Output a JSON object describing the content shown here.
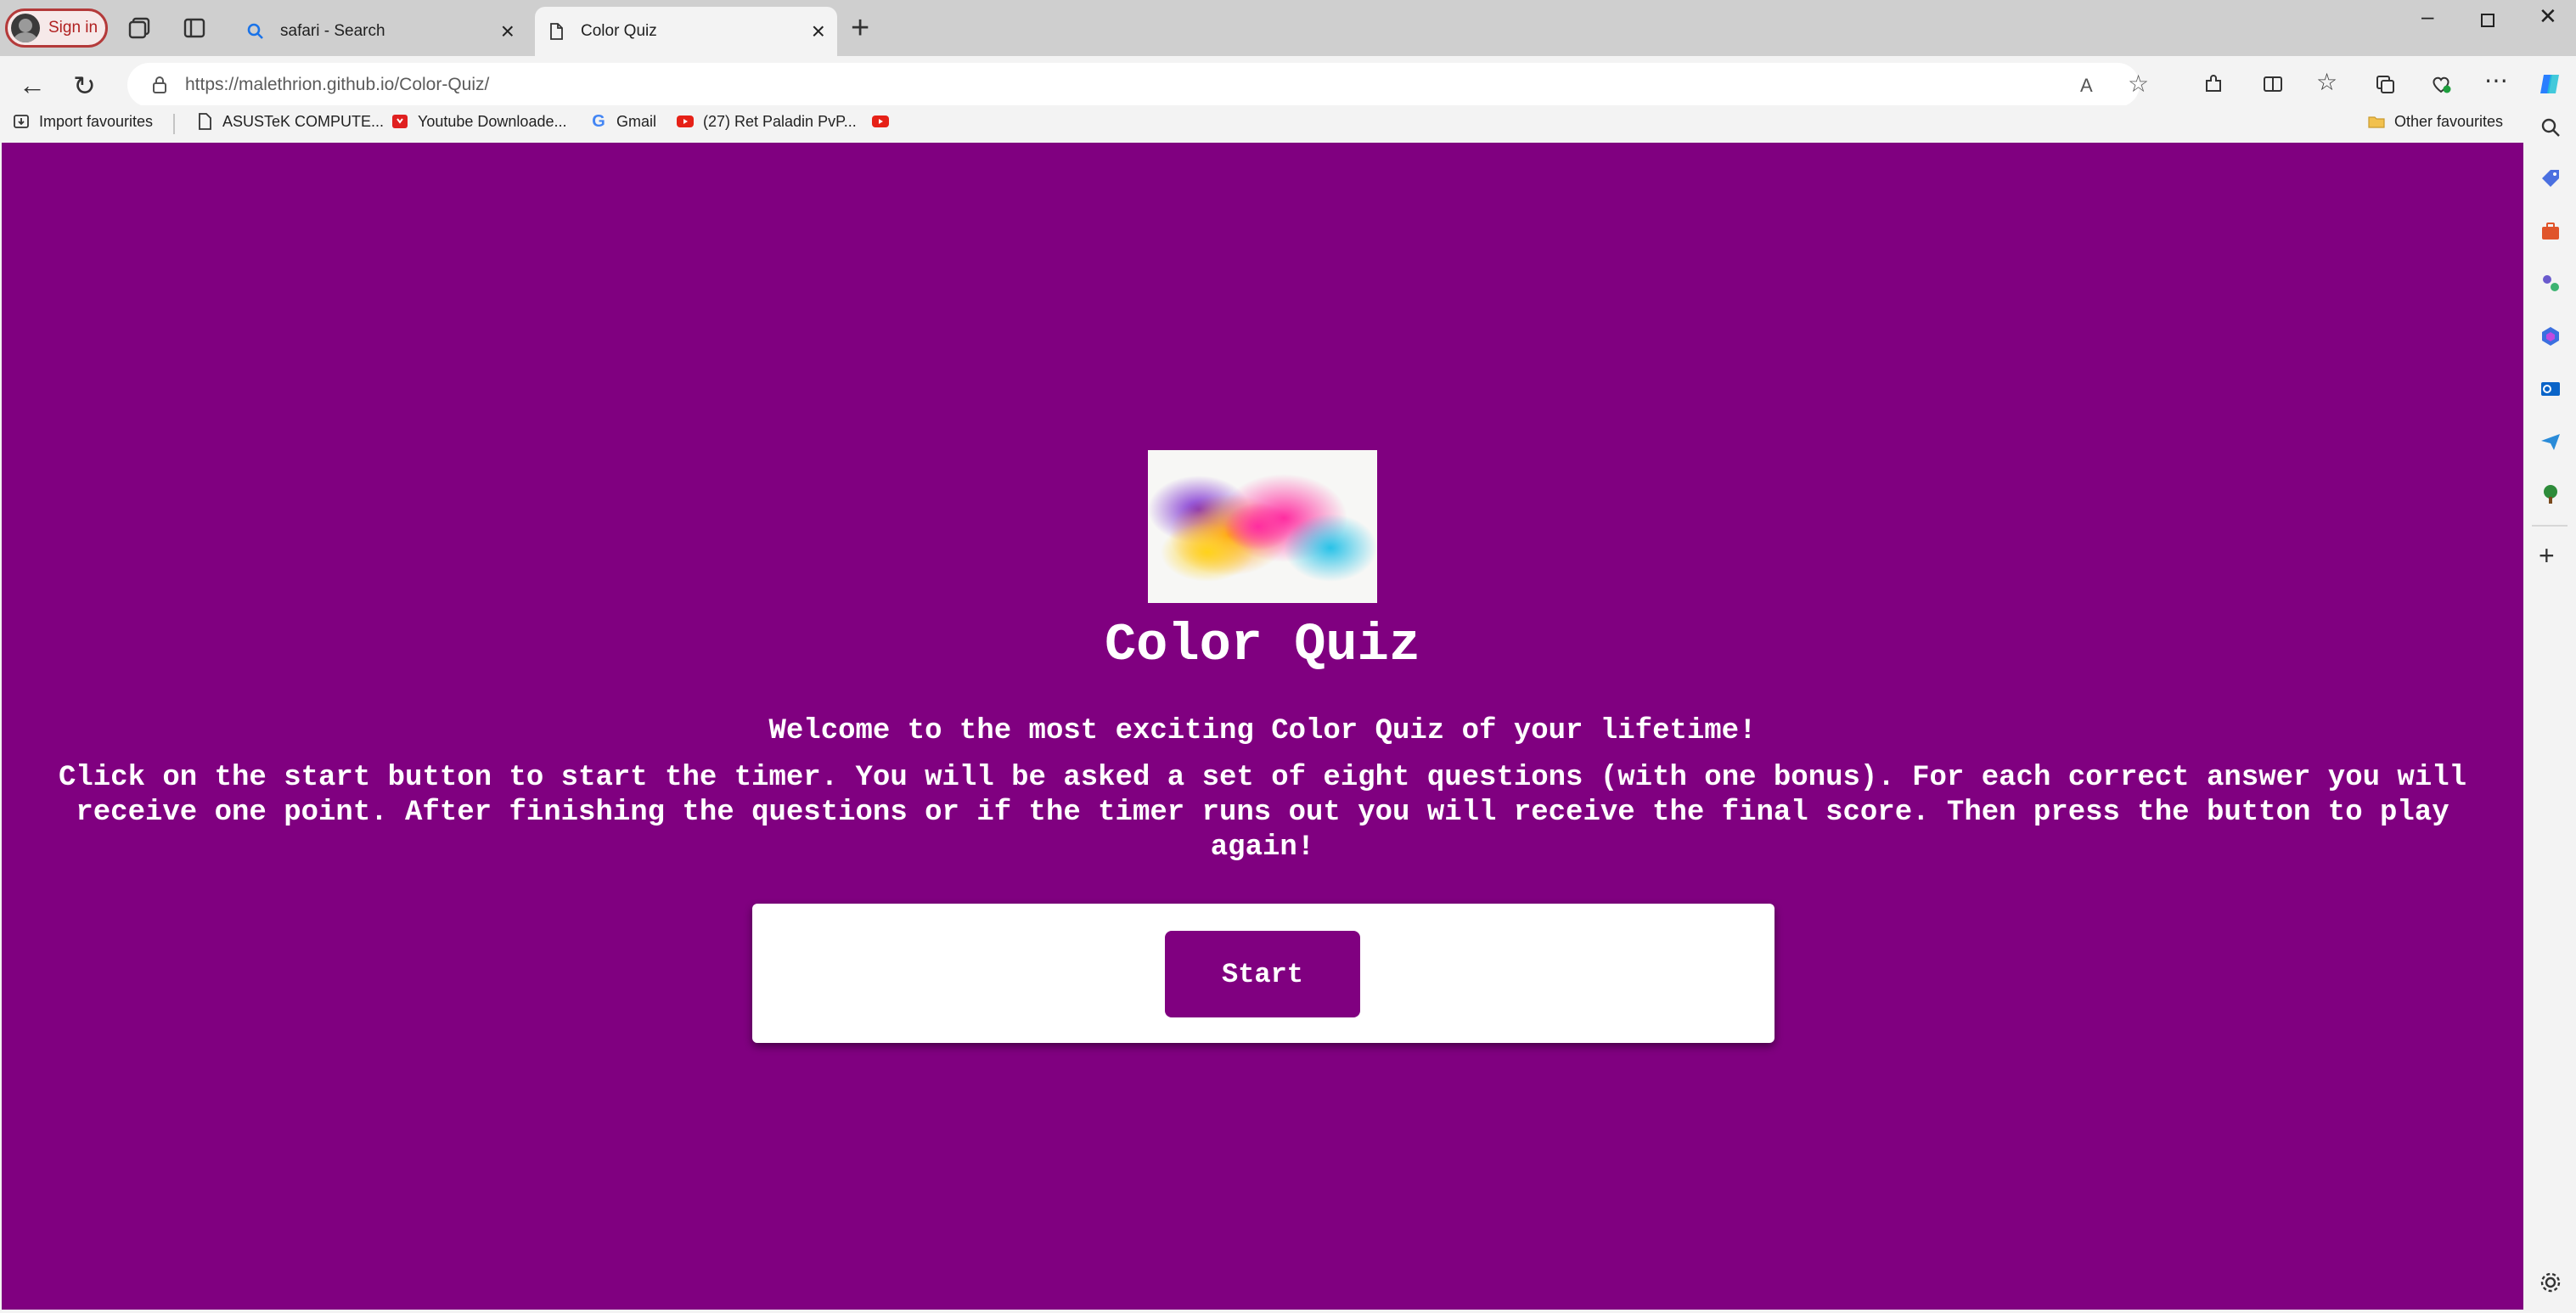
{
  "browser": {
    "signin_label": "Sign in",
    "tabs": [
      {
        "label": "safari - Search",
        "active": false
      },
      {
        "label": "Color Quiz",
        "active": true
      }
    ],
    "url_host": "https://malethrion.github.io",
    "url_path": "/Color-Quiz/",
    "favourites": [
      {
        "label": "Import favourites",
        "icon": "import-icon"
      },
      {
        "label": "ASUSTeK COMPUTE...",
        "icon": "page-icon"
      },
      {
        "label": "Youtube Downloade...",
        "icon": "youtube-downloader-icon"
      },
      {
        "label": "Gmail",
        "icon": "google-icon"
      },
      {
        "label": "(27) Ret Paladin PvP...",
        "icon": "youtube-icon"
      }
    ],
    "other_favourites": "Other favourites"
  },
  "page": {
    "background": "#800080",
    "title": "Color Quiz",
    "welcome": "Welcome to the most exciting Color Quiz of your lifetime!",
    "instructions": "Click on the start button to start the timer. You will be asked a set of eight questions (with one bonus). For each correct answer you will receive one point. After finishing the questions or if the timer runs out you will receive the final score. Then press the button to play again!",
    "start_label": "Start"
  }
}
